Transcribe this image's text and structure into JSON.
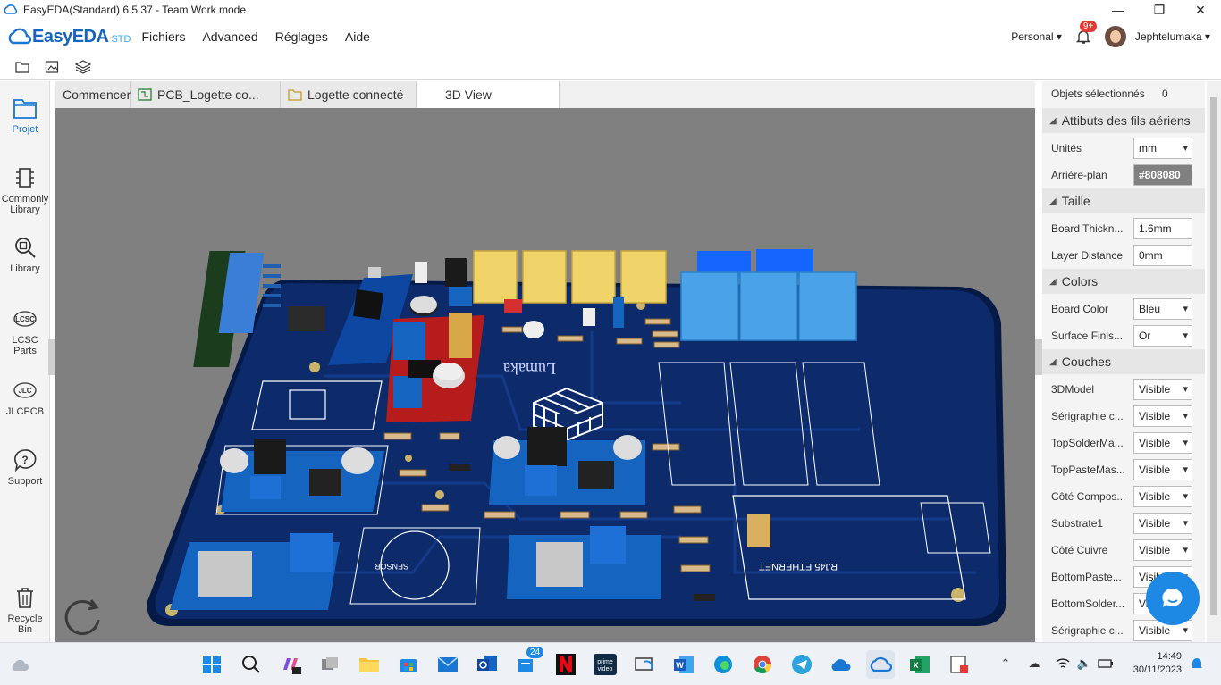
{
  "window": {
    "title": "EasyEDA(Standard) 6.5.37 - Team Work mode",
    "controls": [
      "—",
      "❐",
      "✕"
    ]
  },
  "brand": {
    "name": "EasyEDA",
    "edition": "STD",
    "color": "#1565c0"
  },
  "menu": {
    "items": [
      "Fichiers",
      "Advanced",
      "Réglages",
      "Aide"
    ]
  },
  "account": {
    "workspace": "Personal ▾",
    "notifications": "9+",
    "username": "Jephtelumaka ▾"
  },
  "toolbar": {
    "icons": [
      "folder-icon",
      "export-icon",
      "layers-icon"
    ]
  },
  "sidebar": {
    "items": [
      {
        "label": "Projet",
        "icon": "project-icon",
        "active": true
      },
      {
        "label": "Commonly Library",
        "icon": "chip-icon"
      },
      {
        "label": "Library",
        "icon": "library-search-icon"
      },
      {
        "label": "LCSC Parts",
        "icon": "lcsc-icon"
      },
      {
        "label": "JLCPCB",
        "icon": "jlc-icon"
      },
      {
        "label": "Support",
        "icon": "help-icon"
      },
      {
        "label": "Recycle Bin",
        "icon": "trash-icon"
      }
    ]
  },
  "tabs": [
    {
      "label": "Commencer"
    },
    {
      "label": "PCB_Logette co..."
    },
    {
      "label": "Logette connecté"
    },
    {
      "label": "3D View",
      "active": true
    }
  ],
  "viewport": {
    "background": "#808080",
    "board_color": "#0d2a6b"
  },
  "panel": {
    "selected_label": "Objets sélectionnés",
    "selected_count": "0",
    "sections": {
      "wires": "Attibuts des fils aériens",
      "size": "Taille",
      "colors": "Colors",
      "layers": "Couches"
    },
    "units_label": "Unités",
    "units_value": "mm",
    "background_label": "Arrière-plan",
    "background_value": "#808080",
    "thickness_label": "Board Thickn...",
    "thickness_value": "1.6mm",
    "layer_distance_label": "Layer Distance",
    "layer_distance_value": "0mm",
    "board_color_label": "Board Color",
    "board_color_value": "Bleu",
    "surface_label": "Surface Finis...",
    "surface_value": "Or",
    "layers": [
      {
        "label": "3DModel",
        "value": "Visible"
      },
      {
        "label": "Sérigraphie c...",
        "value": "Visible"
      },
      {
        "label": "TopSolderMa...",
        "value": "Visible"
      },
      {
        "label": "TopPasteMas...",
        "value": "Visible"
      },
      {
        "label": "Côté Compos...",
        "value": "Visible"
      },
      {
        "label": "Substrate1",
        "value": "Visible"
      },
      {
        "label": "Côté Cuivre",
        "value": "Visible"
      },
      {
        "label": "BottomPaste...",
        "value": "Visible"
      },
      {
        "label": "BottomSolder...",
        "value": "Visible"
      },
      {
        "label": "Sérigraphie c...",
        "value": "Visible"
      }
    ]
  },
  "taskbar": {
    "apps": [
      "start-icon",
      "search-icon",
      "copilot-icon",
      "taskview-icon",
      "file-explorer-icon",
      "store-icon",
      "mail-icon",
      "outlook-icon",
      "teams-icon",
      "netflix-icon",
      "prime-video-icon",
      "connect-icon",
      "word-icon",
      "edge-icon",
      "chrome-icon",
      "telegram-icon",
      "onedrive-icon",
      "easyeda-icon",
      "excel-icon",
      "tool-icon"
    ],
    "teams_badge": "24",
    "time": "14:49",
    "date": "30/11/2023"
  }
}
